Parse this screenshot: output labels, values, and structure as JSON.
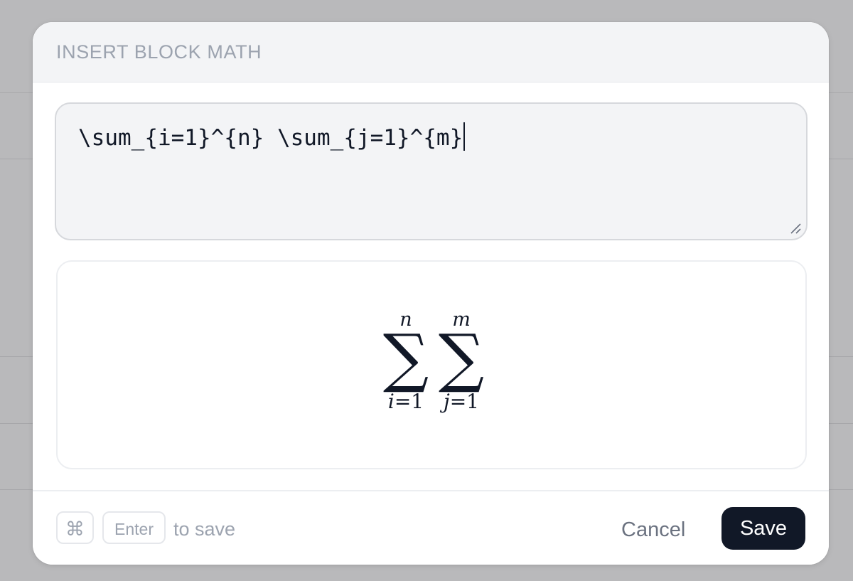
{
  "dialog": {
    "title": "INSERT BLOCK MATH"
  },
  "editor": {
    "value": "\\sum_{i=1}^{n} \\sum_{j=1}^{m}"
  },
  "preview": {
    "sums": [
      {
        "upper": "n",
        "symbol": "∑",
        "lower_var": "i",
        "lower_eq": "=1"
      },
      {
        "upper": "m",
        "symbol": "∑",
        "lower_var": "j",
        "lower_eq": "=1"
      }
    ]
  },
  "footer": {
    "shortcut_key_1": "⌘",
    "shortcut_key_2": "Enter",
    "shortcut_hint": "to save",
    "cancel_label": "Cancel",
    "save_label": "Save"
  },
  "colors": {
    "primary_button": "#111827",
    "header_bg": "#f3f4f6",
    "muted_text": "#9ca3af"
  },
  "icons": [
    "command-icon",
    "resize-handle-icon"
  ]
}
